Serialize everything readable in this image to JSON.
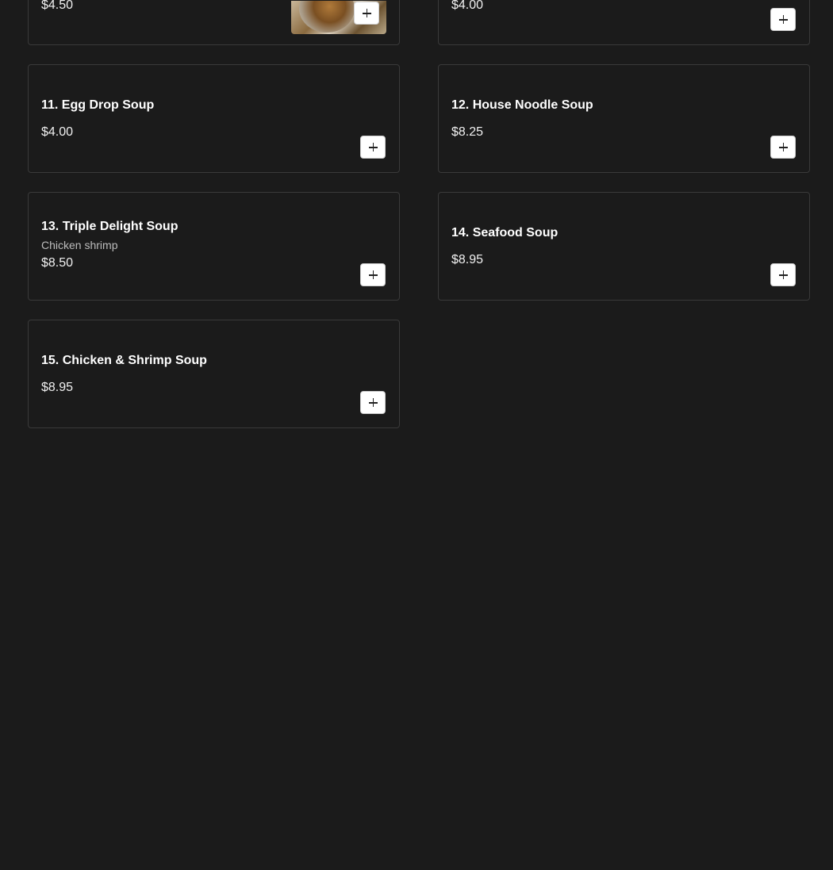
{
  "items": [
    {
      "id": "top-left",
      "price": "$4.50",
      "has_image": true
    },
    {
      "id": "top-right",
      "price": "$4.00"
    },
    {
      "id": "11",
      "title": "11. Egg Drop Soup",
      "price": "$4.00"
    },
    {
      "id": "12",
      "title": "12. House Noodle Soup",
      "price": "$8.25"
    },
    {
      "id": "13",
      "title": "13. Triple Delight Soup",
      "description": "Chicken shrimp",
      "price": "$8.50"
    },
    {
      "id": "14",
      "title": "14. Seafood Soup",
      "price": "$8.95"
    },
    {
      "id": "15",
      "title": "15. Chicken & Shrimp Soup",
      "price": "$8.95"
    }
  ],
  "icons": {
    "add": "plus-icon",
    "photo": "soup-photo"
  },
  "colors": {
    "background": "#1b1b1b",
    "card_border": "#3a3a3a",
    "text": "#ffffff",
    "muted_text": "#bdbdbd",
    "button_bg": "#ffffff"
  }
}
